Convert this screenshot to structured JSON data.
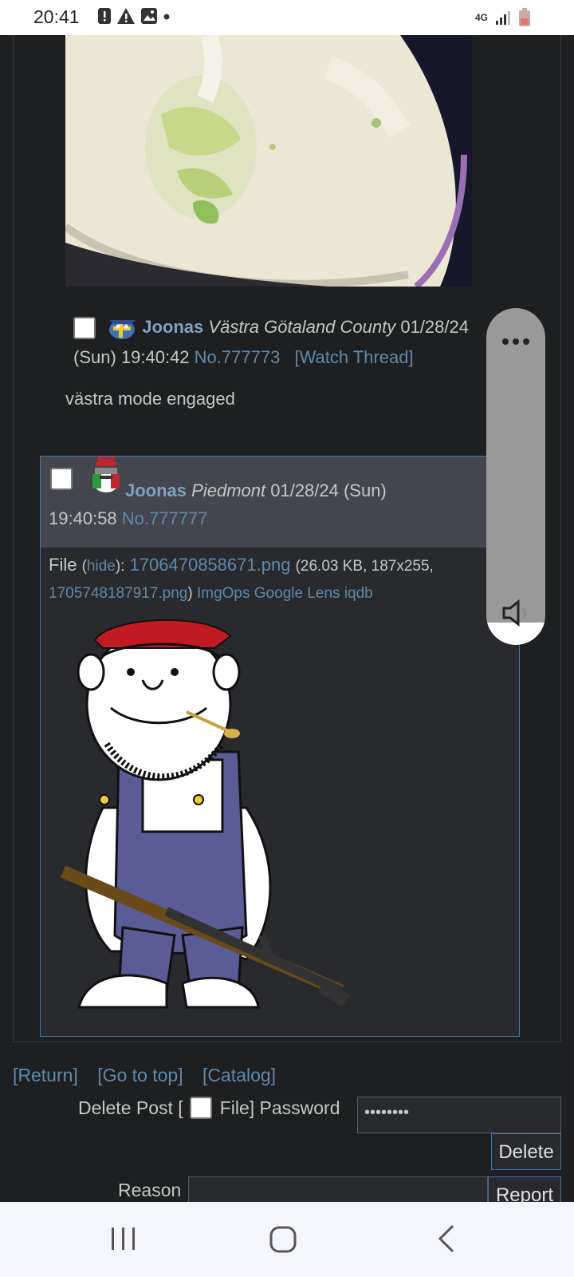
{
  "status_bar": {
    "time": "20:41",
    "network": "4G"
  },
  "op_post": {
    "name": "Joonas",
    "flag_region": "Västra Götaland County",
    "date_part1": "01/28/24",
    "date_part2": "(Sun) 19:40:42",
    "post_no": "No.777773",
    "watch_link": "[Watch Thread]",
    "message": "västra mode engaged"
  },
  "reply_post": {
    "name": "Joonas",
    "flag_region": "Piedmont",
    "date_part1": "01/28/24 (Sun)",
    "date_part2": "19:40:58",
    "post_no": "No.777777",
    "file_label": "File",
    "hide_link": "hide",
    "file_name": "1706470858671.png",
    "file_meta": "(26.03 KB, 187x255,",
    "orig_name": "1705748187917.png",
    "file_tools": [
      "ImgOps",
      "Google Lens",
      "iqdb"
    ]
  },
  "footer": {
    "links": [
      "[Return]",
      "[Go to top]",
      "[Catalog]"
    ],
    "delete_label_start": "Delete Post [",
    "delete_label_end": "File] Password",
    "password_value": "••••••••",
    "delete_button": "Delete",
    "reason_label": "Reason",
    "report_button": "Report"
  },
  "colors": {
    "background": "#1d1f21",
    "name": "#81a2be",
    "link": "#5f89ac",
    "reply_border": "#3e78b2"
  }
}
